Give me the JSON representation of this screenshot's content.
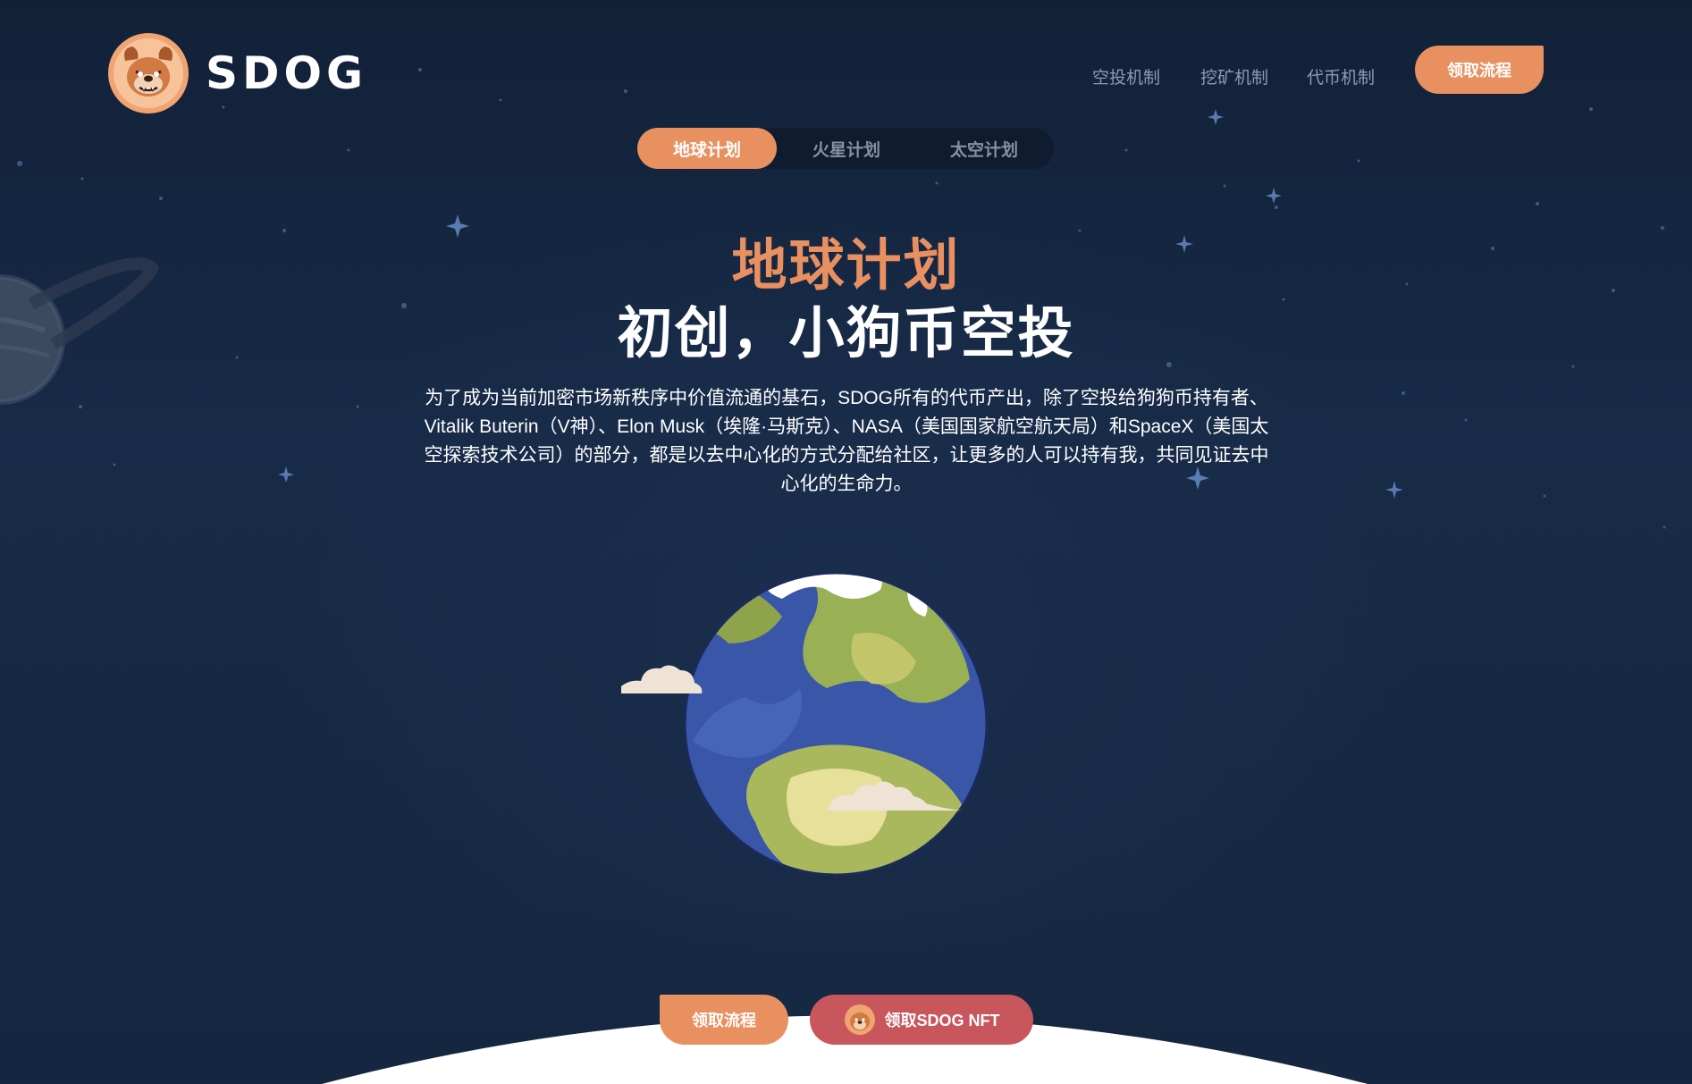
{
  "brand": {
    "name": "SDOG",
    "accent": "#e89060",
    "nft_button_color": "#c9565c",
    "logo_icon": "bulldog-mascot-icon"
  },
  "nav": {
    "items": [
      "空投机制",
      "挖矿机制",
      "代币机制"
    ],
    "cta_label": "领取流程"
  },
  "tabs": {
    "items": [
      "地球计划",
      "火星计划",
      "太空计划"
    ],
    "active_index": 0
  },
  "hero": {
    "title_orange": "地球计划",
    "title_white": "初创，小狗币空投",
    "description": "为了成为当前加密市场新秩序中价值流通的基石，SDOG所有的代币产出，除了空投给狗狗币持有者、Vitalik Buterin（V神）、Elon Musk（埃隆·马斯克）、NASA（美国国家航空航天局）和SpaceX（美国太空探索技术公司）的部分，都是以去中心化的方式分配给社区，让更多的人可以持有我，共同见证去中心化的生命力。",
    "image_icon": "earth-globe-icon"
  },
  "actions": {
    "primary_label": "领取流程",
    "nft_label": "领取SDOG NFT"
  }
}
